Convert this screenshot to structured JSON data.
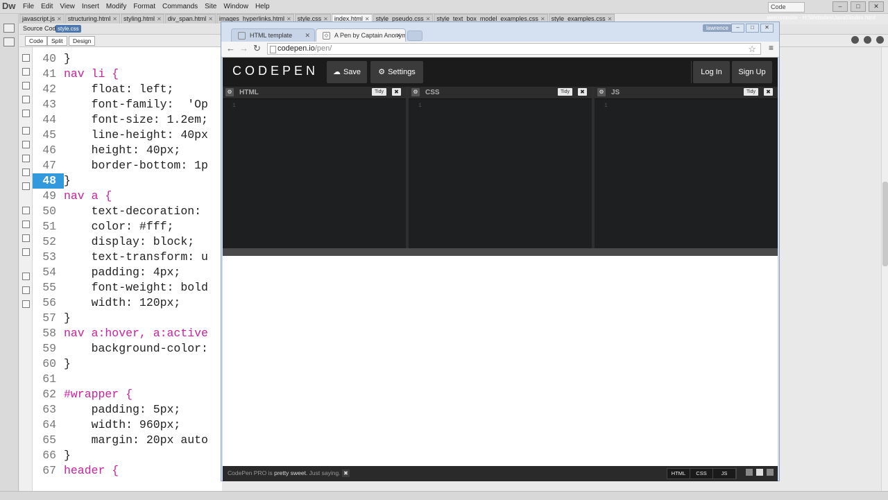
{
  "dreamweaver": {
    "logo": "Dw",
    "menus": [
      "File",
      "Edit",
      "View",
      "Insert",
      "Modify",
      "Format",
      "Commands",
      "Site",
      "Window",
      "Help"
    ],
    "workspace": "Code",
    "doc_tabs": [
      {
        "label": "javascript.js",
        "active": false
      },
      {
        "label": "structuring.html",
        "active": false
      },
      {
        "label": "styling.html",
        "active": false
      },
      {
        "label": "div_span.html",
        "active": false
      },
      {
        "label": "images_hyperlinks.html",
        "active": false
      },
      {
        "label": "style.css",
        "active": false
      },
      {
        "label": "index.html",
        "active": true
      },
      {
        "label": "style_pseudo.css",
        "active": false
      },
      {
        "label": "style_text_box_model_examples.css",
        "active": false
      },
      {
        "label": "style_examples.css",
        "active": false
      }
    ],
    "path": "welcomesite - H:\\Websites\\Java5\\index.html",
    "source_code_label": "Source Code",
    "source_file": "style.css",
    "view_buttons": [
      "Code",
      "Split",
      "Design"
    ],
    "code_lines": [
      {
        "n": "40",
        "t": "}",
        "kind": "tx"
      },
      {
        "n": "41",
        "t": "nav li {",
        "kind": "sel"
      },
      {
        "n": "42",
        "t": "    float: left;",
        "kind": "tx"
      },
      {
        "n": "43",
        "t": "    font-family:  'Op",
        "kind": "tx"
      },
      {
        "n": "44",
        "t": "    font-size: 1.2em;",
        "kind": "tx"
      },
      {
        "n": "45",
        "t": "    line-height: 40px",
        "kind": "tx"
      },
      {
        "n": "46",
        "t": "    height: 40px;",
        "kind": "tx"
      },
      {
        "n": "47",
        "t": "    border-bottom: 1p",
        "kind": "tx"
      },
      {
        "n": "48",
        "t": "}",
        "kind": "tx",
        "current": true
      },
      {
        "n": "49",
        "t": "nav a {",
        "kind": "sel"
      },
      {
        "n": "50",
        "t": "    text-decoration:",
        "kind": "tx"
      },
      {
        "n": "51",
        "t": "    color: #fff;",
        "kind": "tx"
      },
      {
        "n": "52",
        "t": "    display: block;",
        "kind": "tx"
      },
      {
        "n": "53",
        "t": "    text-transform: u",
        "kind": "tx"
      },
      {
        "n": "54",
        "t": "    padding: 4px;",
        "kind": "tx"
      },
      {
        "n": "55",
        "t": "    font-weight: bold",
        "kind": "tx"
      },
      {
        "n": "56",
        "t": "    width: 120px;",
        "kind": "tx"
      },
      {
        "n": "57",
        "t": "}",
        "kind": "tx"
      },
      {
        "n": "58",
        "t": "nav a:hover, a:active",
        "kind": "sel"
      },
      {
        "n": "59",
        "t": "    background-color:",
        "kind": "tx"
      },
      {
        "n": "60",
        "t": "}",
        "kind": "tx"
      },
      {
        "n": "61",
        "t": "",
        "kind": "tx"
      },
      {
        "n": "62",
        "t": "#wrapper {",
        "kind": "sel"
      },
      {
        "n": "63",
        "t": "    padding: 5px;",
        "kind": "tx"
      },
      {
        "n": "64",
        "t": "    width: 960px;",
        "kind": "tx"
      },
      {
        "n": "65",
        "t": "    margin: 20px auto",
        "kind": "tx"
      },
      {
        "n": "66",
        "t": "}",
        "kind": "tx"
      },
      {
        "n": "67",
        "t": "header {",
        "kind": "sel"
      }
    ]
  },
  "browser": {
    "tabs": [
      {
        "label": "HTML template",
        "active": false
      },
      {
        "label": "A Pen by Captain Anonym",
        "active": true
      }
    ],
    "user_badge": "lawrence",
    "url_host": "codepen.io",
    "url_path": "/pen/"
  },
  "codepen": {
    "logo": "CODEPEN",
    "save_label": "Save",
    "settings_label": "Settings",
    "login_label": "Log In",
    "signup_label": "Sign Up",
    "editors": [
      {
        "name": "HTML",
        "tidy": "Tidy",
        "line": "1"
      },
      {
        "name": "CSS",
        "tidy": "Tidy",
        "line": "1"
      },
      {
        "name": "JS",
        "tidy": "Tidy",
        "line": "1"
      }
    ],
    "footer_msg_prefix": "CodePen PRO is",
    "footer_msg_bold": "pretty sweet.",
    "footer_msg_suffix": "Just saying.",
    "footer_toggles": [
      "HTML",
      "CSS",
      "JS"
    ]
  },
  "colors": {
    "selector": "#cc1fa0",
    "current_line": "#3399dd",
    "codepen_bg": "#1d1f20"
  }
}
